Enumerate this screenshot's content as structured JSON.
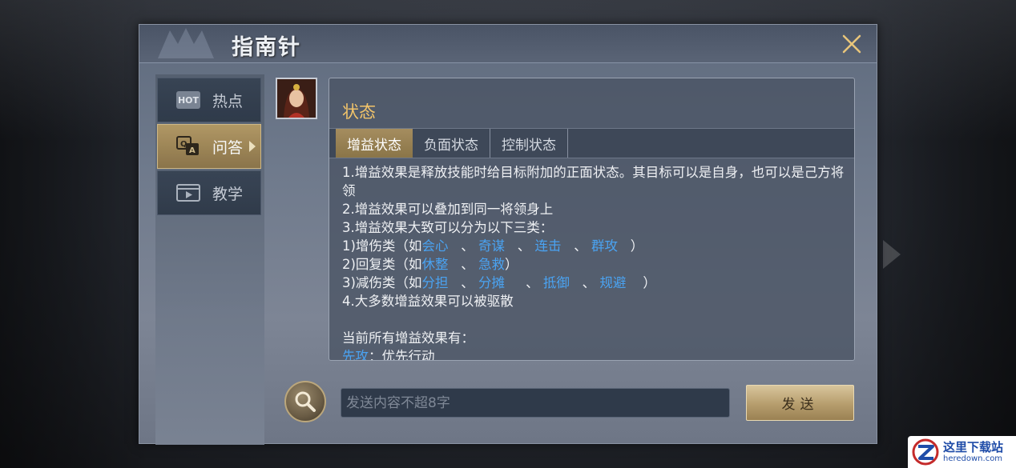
{
  "dialog": {
    "title": "指南针"
  },
  "sidebar": {
    "items": [
      {
        "label": "热点",
        "icon": "hot-icon",
        "badge": "HOT",
        "active": false
      },
      {
        "label": "问答",
        "icon": "qa-icon",
        "active": true
      },
      {
        "label": "教学",
        "icon": "video-icon",
        "active": false
      }
    ]
  },
  "content": {
    "title": "状态",
    "tabs": [
      {
        "label": "增益状态",
        "active": true
      },
      {
        "label": "负面状态",
        "active": false
      },
      {
        "label": "控制状态",
        "active": false
      }
    ],
    "lines": {
      "l1": "1.增益效果是释放技能时给目标附加的正面状态。其目标可以是自身，也可以是己方将领",
      "l2": "2.增益效果可以叠加到同一将领身上",
      "l3": "3.增益效果大致可以分为以下三类：",
      "l4_prefix": "1)增伤类（如",
      "l4_kw": [
        "会心",
        "奇谋",
        "连击",
        "群攻"
      ],
      "l4_suffix": "）",
      "l5_prefix": "2)回复类（如",
      "l5_kw": [
        "休整",
        "急救"
      ],
      "l5_suffix": "）",
      "l6_prefix": "3)减伤类（如",
      "l6_kw": [
        "分担",
        "分摊",
        "抵御",
        "规避"
      ],
      "l6_suffix": "）",
      "l7": "4.大多数增益效果可以被驱散",
      "l8": "当前所有增益效果有：",
      "l9_kw": "先攻",
      "l9_rest": "：优先行动"
    },
    "separator": "、"
  },
  "input": {
    "placeholder": "发送内容不超8字",
    "value": ""
  },
  "send_button": {
    "label": "发送"
  },
  "watermark": {
    "title": "这里下载站",
    "sub": "heredown.com"
  },
  "colors": {
    "accent_gold": "#f2c46a",
    "keyword_blue": "#4aa3f2",
    "active_tab": "#a58d5f"
  }
}
